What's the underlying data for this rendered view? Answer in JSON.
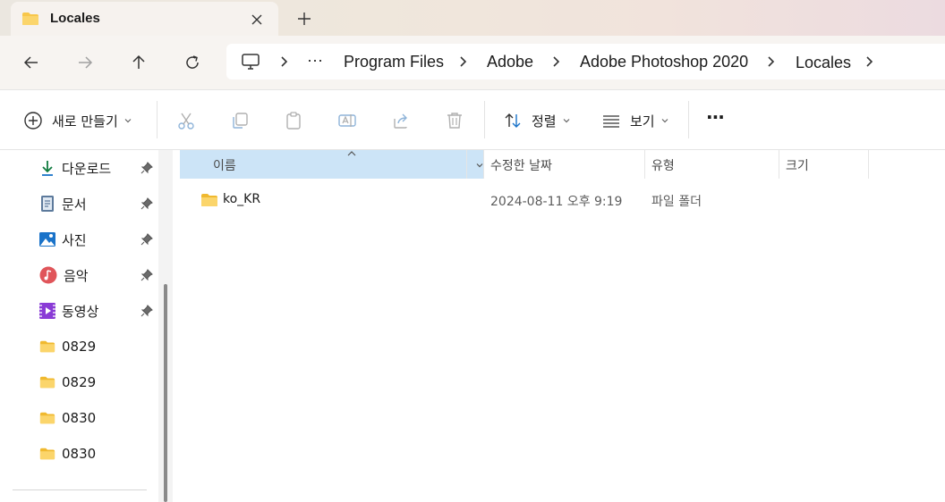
{
  "window": {
    "tab_title": "Locales"
  },
  "address": {
    "ellipsis": "···",
    "crumbs": [
      "Program Files",
      "Adobe",
      "Adobe Photoshop 2020",
      "Locales"
    ]
  },
  "toolbar": {
    "new_label": "새로 만들기",
    "sort_label": "정렬",
    "view_label": "보기",
    "more_label": "···"
  },
  "sidebar": {
    "items": [
      {
        "label": "다운로드",
        "icon": "download-icon",
        "pinned": true
      },
      {
        "label": "문서",
        "icon": "document-icon",
        "pinned": true
      },
      {
        "label": "사진",
        "icon": "pictures-icon",
        "pinned": true
      },
      {
        "label": "음악",
        "icon": "music-icon",
        "pinned": true
      },
      {
        "label": "동영상",
        "icon": "videos-icon",
        "pinned": true
      },
      {
        "label": "0829",
        "icon": "folder-icon",
        "pinned": false
      },
      {
        "label": "0829",
        "icon": "folder-icon",
        "pinned": false
      },
      {
        "label": "0830",
        "icon": "folder-icon",
        "pinned": false
      },
      {
        "label": "0830",
        "icon": "folder-icon",
        "pinned": false
      }
    ]
  },
  "columns": {
    "name": "이름",
    "modified": "수정한 날짜",
    "type": "유형",
    "size": "크기"
  },
  "files": [
    {
      "name": "ko_KR",
      "modified": "2024-08-11 오후 9:19",
      "type": "파일 폴더",
      "size": ""
    }
  ],
  "colors": {
    "folder": "#f8c74a",
    "selected_header": "#cce4f7",
    "download_accent": "#0f7b3f",
    "pictures_accent": "#1a73c9",
    "music_accent": "#e0555a",
    "videos_accent": "#8a3bd6"
  }
}
